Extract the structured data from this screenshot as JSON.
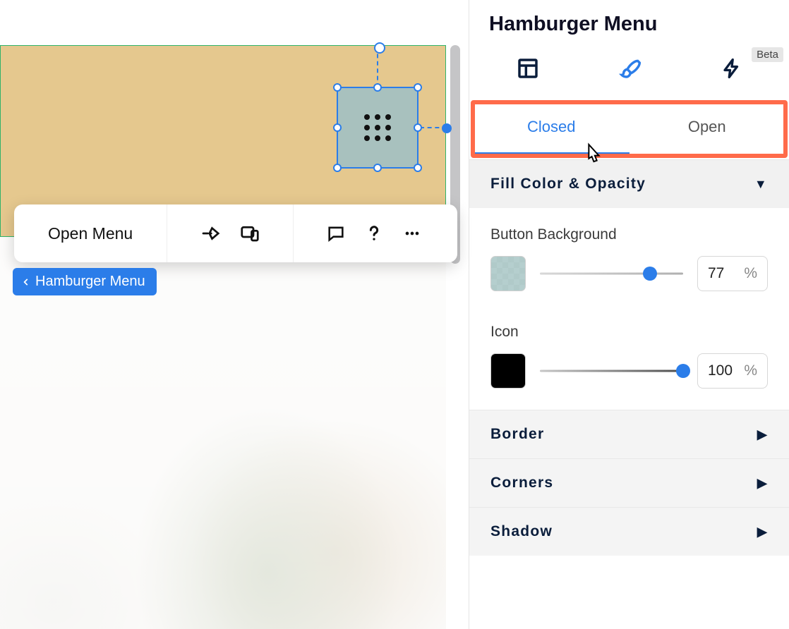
{
  "panel": {
    "title": "Hamburger Menu",
    "beta_label": "Beta",
    "mode_icons": [
      "layout-icon",
      "brush-icon",
      "bolt-icon"
    ],
    "active_mode_index": 1,
    "state_tabs": [
      "Closed",
      "Open"
    ],
    "active_state_index": 0
  },
  "sections": {
    "fill": {
      "title": "Fill Color & Opacity",
      "expanded": true,
      "props": {
        "button_bg": {
          "label": "Button Background",
          "opacity": "77",
          "unit": "%",
          "slider_pct": 77,
          "swatch_color": "#9fc0bf"
        },
        "icon": {
          "label": "Icon",
          "opacity": "100",
          "unit": "%",
          "slider_pct": 100,
          "swatch_color": "#000000"
        }
      }
    },
    "border": {
      "title": "Border",
      "expanded": false
    },
    "corners": {
      "title": "Corners",
      "expanded": false
    },
    "shadow": {
      "title": "Shadow",
      "expanded": false
    }
  },
  "canvas": {
    "floating_toolbar": {
      "open_menu_label": "Open Menu",
      "icons": [
        "animate-icon",
        "devices-icon",
        "comment-icon",
        "help-icon",
        "more-icon"
      ]
    },
    "breadcrumb": {
      "label": "Hamburger Menu"
    }
  }
}
